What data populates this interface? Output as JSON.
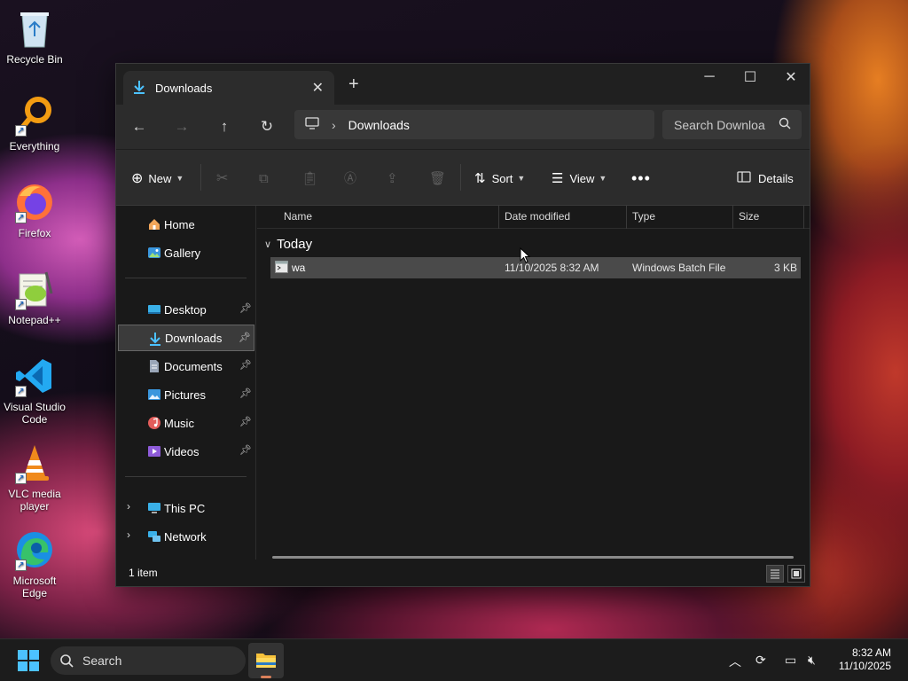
{
  "desktop": {
    "icons": [
      {
        "label": "Recycle Bin",
        "icon": "recycle-bin-icon"
      },
      {
        "label": "Everything",
        "icon": "everything-icon"
      },
      {
        "label": "Firefox",
        "icon": "firefox-icon"
      },
      {
        "label": "Notepad++",
        "icon": "notepad-plus-plus-icon"
      },
      {
        "label": "Visual Studio Code",
        "icon": "vscode-icon"
      },
      {
        "label": "VLC media player",
        "icon": "vlc-icon"
      },
      {
        "label": "Microsoft Edge",
        "icon": "edge-icon"
      }
    ]
  },
  "window": {
    "tab_title": "Downloads",
    "address": {
      "crumb": "Downloads"
    },
    "search_placeholder": "Search Downloa",
    "toolbar": {
      "new_label": "New",
      "sort_label": "Sort",
      "view_label": "View",
      "details_label": "Details"
    },
    "nav": {
      "top": [
        {
          "label": "Home",
          "icon": "home-icon"
        },
        {
          "label": "Gallery",
          "icon": "gallery-icon"
        }
      ],
      "pinned": [
        {
          "label": "Desktop",
          "icon": "desktop-icon"
        },
        {
          "label": "Downloads",
          "icon": "download-icon",
          "selected": true
        },
        {
          "label": "Documents",
          "icon": "documents-icon"
        },
        {
          "label": "Pictures",
          "icon": "pictures-icon"
        },
        {
          "label": "Music",
          "icon": "music-icon"
        },
        {
          "label": "Videos",
          "icon": "videos-icon"
        }
      ],
      "bottom": [
        {
          "label": "This PC",
          "icon": "this-pc-icon"
        },
        {
          "label": "Network",
          "icon": "network-icon"
        }
      ]
    },
    "columns": [
      "Name",
      "Date modified",
      "Type",
      "Size"
    ],
    "group": "Today",
    "files": [
      {
        "name": "wa",
        "date": "11/10/2025 8:32 AM",
        "type": "Windows Batch File",
        "size": "3 KB"
      }
    ],
    "status": "1 item"
  },
  "taskbar": {
    "search_label": "Search",
    "time": "8:32 AM",
    "date": "11/10/2025"
  },
  "colors": {
    "accent": "#4cc2ff",
    "window_bg": "#191919",
    "chrome_bg": "#2c2c2c"
  }
}
